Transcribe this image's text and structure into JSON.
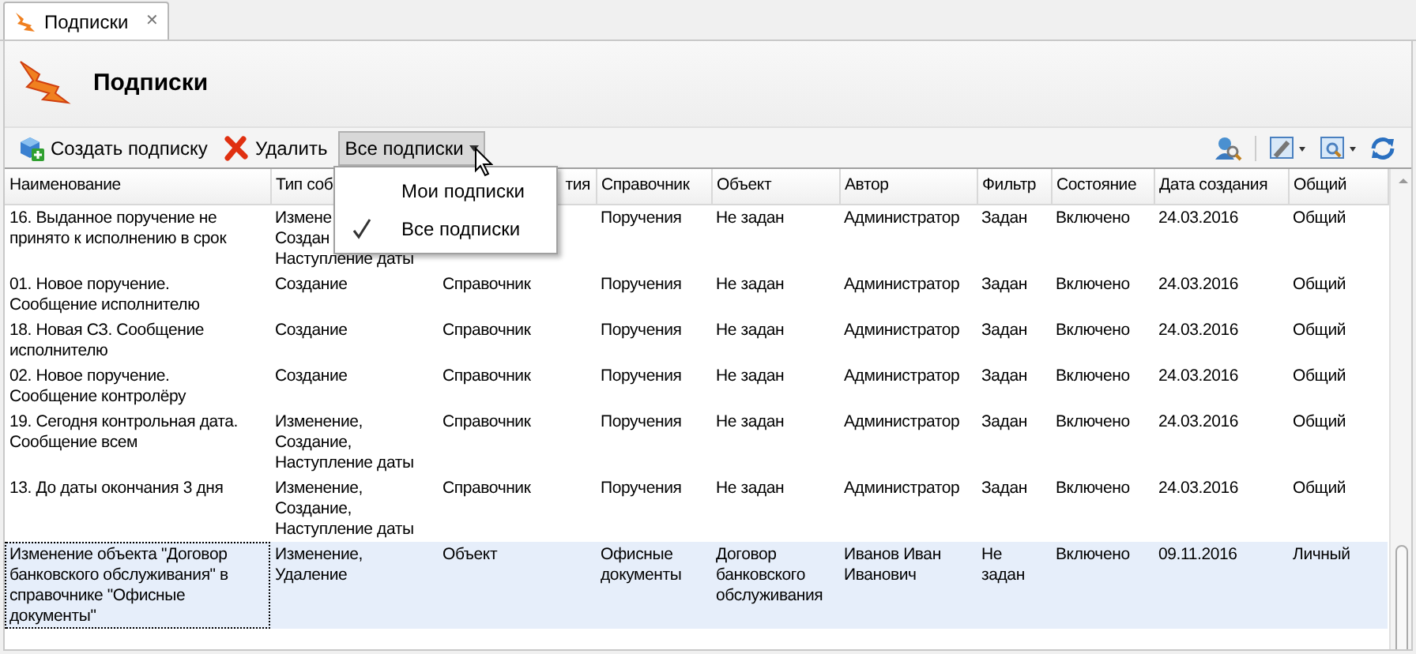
{
  "tab": {
    "label": "Подписки",
    "close": "✕",
    "selected": true
  },
  "title": "Подписки",
  "toolbar": {
    "buttons": [
      {
        "kind": "create",
        "label": "Создать подписку"
      },
      {
        "kind": "delete",
        "label": "Удалить"
      },
      {
        "kind": "dropdown",
        "label": "Все подписки",
        "pressed": true
      }
    ]
  },
  "menu": [
    {
      "label": "Мои подписки",
      "checked": false
    },
    {
      "label": "Все подписки",
      "checked": true
    }
  ],
  "table": {
    "columns": [
      {
        "kind": "plain",
        "label": "Наименование"
      },
      {
        "kind": "plain",
        "label": "Тип соб"
      },
      {
        "kind": "tail",
        "label": "тия"
      },
      {
        "kind": "plain",
        "label": "Справочник"
      },
      {
        "kind": "plain",
        "label": "Объект"
      },
      {
        "kind": "plain",
        "label": "Автор"
      },
      {
        "kind": "plain",
        "label": "Фильтр"
      },
      {
        "kind": "plain",
        "label": "Состояние"
      },
      {
        "kind": "plain",
        "label": "Дата создания"
      },
      {
        "kind": "plain",
        "label": "Общий"
      }
    ],
    "rows": [
      {
        "selected": false,
        "cells": [
          "16. Выданное поручение не принято к исполнению в срок",
          "Измене\nСоздан\nНаступление даты",
          null,
          "Поручения",
          "Не задан",
          "Администратор",
          "Задан",
          "Включено",
          "24.03.2016",
          "Общий"
        ]
      },
      {
        "selected": false,
        "cells": [
          "01. Новое поручение. Сообщение исполнителю",
          "Создание",
          "Справочник",
          "Поручения",
          "Не задан",
          "Администратор",
          "Задан",
          "Включено",
          "24.03.2016",
          "Общий"
        ]
      },
      {
        "selected": false,
        "cells": [
          "18. Новая СЗ. Сообщение исполнителю",
          "Создание",
          "Справочник",
          "Поручения",
          "Не задан",
          "Администратор",
          "Задан",
          "Включено",
          "24.03.2016",
          "Общий"
        ]
      },
      {
        "selected": false,
        "cells": [
          "02. Новое поручение. Сообщение контролёру",
          "Создание",
          "Справочник",
          "Поручения",
          "Не задан",
          "Администратор",
          "Задан",
          "Включено",
          "24.03.2016",
          "Общий"
        ]
      },
      {
        "selected": false,
        "cells": [
          "19. Сегодня контрольная дата. Сообщение всем",
          "Изменение, Создание, Наступление даты",
          "Справочник",
          "Поручения",
          "Не задан",
          "Администратор",
          "Задан",
          "Включено",
          "24.03.2016",
          "Общий"
        ]
      },
      {
        "selected": false,
        "cells": [
          "13. До даты окончания 3 дня",
          "Изменение, Создание, Наступление даты",
          "Справочник",
          "Поручения",
          "Не задан",
          "Администратор",
          "Задан",
          "Включено",
          "24.03.2016",
          "Общий"
        ]
      },
      {
        "selected": true,
        "cells": [
          "Изменение объекта \"Договор банковского обслуживания\" в справочнике \"Офисные документы\"",
          "Изменение, Удаление",
          "Объект",
          "Офисные документы",
          "Договор банковского обслуживания",
          "Иванов Иван Иванович",
          "Не задан",
          "Включено",
          "09.11.2016",
          "Личный"
        ]
      }
    ]
  }
}
